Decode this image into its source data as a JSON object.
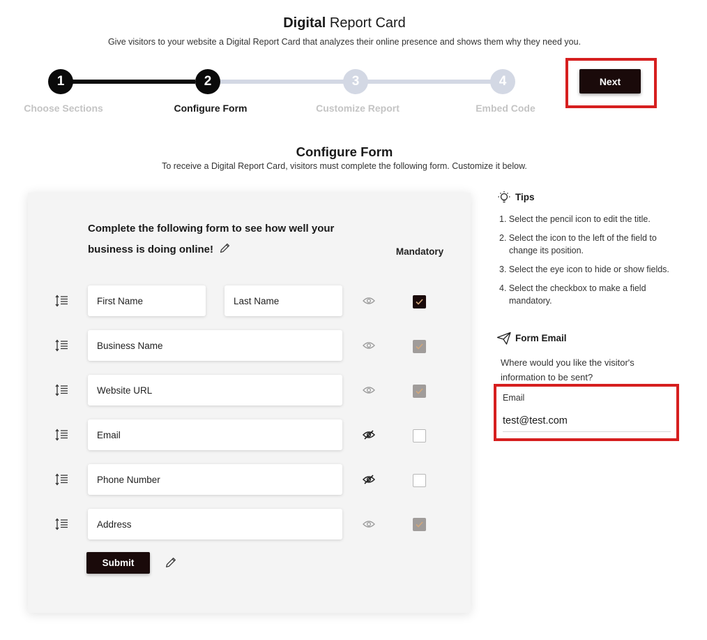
{
  "header": {
    "title_bold": "Digital",
    "title_rest": " Report Card",
    "subtitle": "Give visitors to your website a Digital Report Card that analyzes their online presence and shows them why they need you."
  },
  "stepper": {
    "steps": [
      {
        "number": "1",
        "label": "Choose Sections",
        "state": "done"
      },
      {
        "number": "2",
        "label": "Configure Form",
        "state": "current"
      },
      {
        "number": "3",
        "label": "Customize Report",
        "state": "upcoming"
      },
      {
        "number": "4",
        "label": "Embed Code",
        "state": "upcoming"
      }
    ],
    "next_label": "Next"
  },
  "section": {
    "title": "Configure Form",
    "subtitle": "To receive a Digital Report Card, visitors must complete the following form. Customize it below."
  },
  "form": {
    "heading_line1": "Complete the following form to see how well your",
    "heading_line2": "business is doing online!",
    "mandatory_header": "Mandatory",
    "fields": [
      {
        "placeholder": "First Name",
        "visible": true,
        "mandatory": "checked-dark"
      },
      {
        "placeholder": "Last Name"
      },
      {
        "placeholder": "Business Name",
        "visible": true,
        "mandatory": "checked-locked"
      },
      {
        "placeholder": "Website URL",
        "visible": true,
        "mandatory": "checked-locked"
      },
      {
        "placeholder": "Email",
        "visible": false,
        "mandatory": "unchecked"
      },
      {
        "placeholder": "Phone Number",
        "visible": false,
        "mandatory": "unchecked"
      },
      {
        "placeholder": "Address",
        "visible": true,
        "mandatory": "checked-locked"
      }
    ],
    "submit_label": "Submit"
  },
  "tips": {
    "title": "Tips",
    "items": [
      "1. Select the pencil icon to edit the title.",
      "2. Select the icon to the left of the field to change its position.",
      "3. Select the eye icon to hide or show fields.",
      "4. Select the checkbox to make a field mandatory."
    ]
  },
  "form_email": {
    "title": "Form Email",
    "question": "Where would you like the visitor's information to be sent?",
    "label": "Email",
    "value": "test@test.com"
  },
  "icons": {
    "tips": "lightbulb-icon",
    "form_email": "paper-plane-icon",
    "edit": "pencil-icon",
    "reorder": "drag-handle-icon",
    "visibility_on": "eye-icon",
    "visibility_off": "eye-slash-icon"
  },
  "colors": {
    "primary_dark": "#1a0a0a",
    "stepper_inactive": "#d3d8e4",
    "annotation_red": "#d61f1f",
    "card_bg": "#f4f4f4"
  }
}
